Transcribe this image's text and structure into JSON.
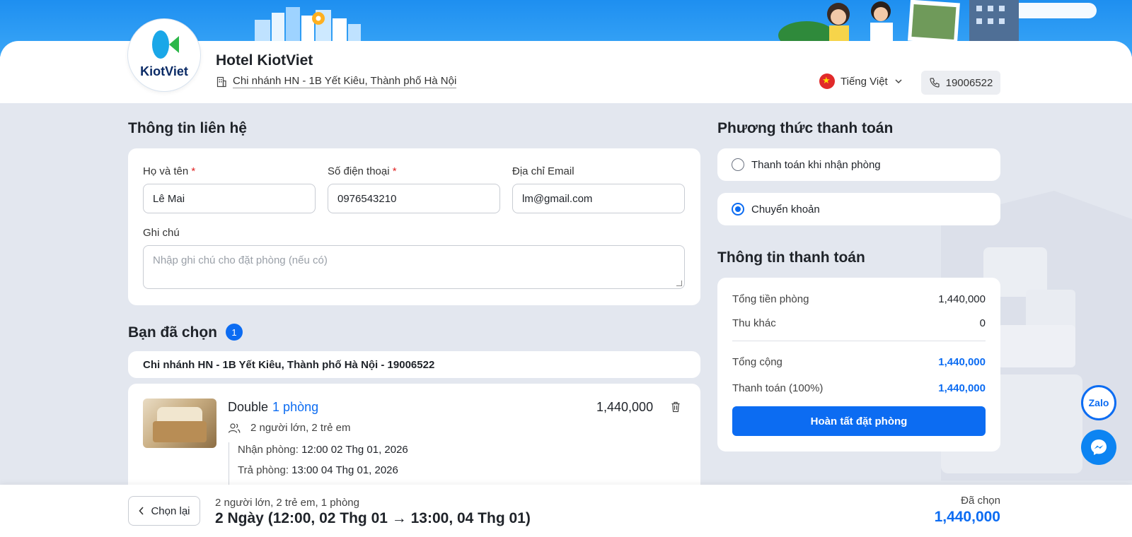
{
  "header": {
    "hotel_name": "Hotel KiotViet",
    "logo_text": "KiotViet",
    "branch": "Chi nhánh HN - 1B Yết Kiêu, Thành phố Hà Nội",
    "language": "Tiếng Việt",
    "phone": "19006522"
  },
  "contact": {
    "title": "Thông tin liên hệ",
    "name_label": "Họ và tên",
    "name_value": "Lê Mai",
    "phone_label": "Số điện thoại",
    "phone_value": "0976543210",
    "email_label": "Địa chỉ Email",
    "email_value": "lm@gmail.com",
    "note_label": "Ghi chú",
    "note_placeholder": "Nhập ghi chú cho đặt phòng (nếu có)",
    "required_mark": "*"
  },
  "selected": {
    "title": "Bạn đã chọn",
    "count": "1",
    "branch_line": "Chi nhánh HN - 1B Yết Kiêu, Thành phố Hà Nội - 19006522",
    "room": {
      "type": "Double",
      "qty": "1 phòng",
      "price": "1,440,000",
      "guests": "2 người lớn, 2 trẻ em",
      "checkin_label": "Nhận phòng:",
      "checkin_value": "12:00 02 Thg 01, 2026",
      "checkout_label": "Trả phòng:",
      "checkout_value": "13:00 04 Thg 01, 2026"
    }
  },
  "payment_method": {
    "title": "Phương thức thanh toán",
    "options": [
      {
        "label": "Thanh toán khi nhận phòng",
        "selected": false
      },
      {
        "label": "Chuyển khoản",
        "selected": true
      }
    ]
  },
  "payment_info": {
    "title": "Thông tin thanh toán",
    "rows": [
      {
        "label": "Tổng tiền phòng",
        "value": "1,440,000"
      },
      {
        "label": "Thu khác",
        "value": "0"
      },
      {
        "label": "Tổng cộng",
        "value": "1,440,000"
      },
      {
        "label": "Thanh toán (100%)",
        "value": "1,440,000"
      }
    ],
    "submit_label": "Hoàn tất đặt phòng"
  },
  "chat": {
    "zalo_label": "Zalo"
  },
  "bottom": {
    "back_label": "Chọn lại",
    "summary_small": "2 người lớn, 2 trẻ em, 1 phòng",
    "summary_big": "2 Ngày (12:00, 02 Thg 01 → 13:00, 04 Thg 01)",
    "chosen_label": "Đã chọn",
    "chosen_value": "1,440,000"
  },
  "colors": {
    "accent": "#0c6cf2",
    "background": "#e3e7ef",
    "banner": "#1e8ff0"
  }
}
